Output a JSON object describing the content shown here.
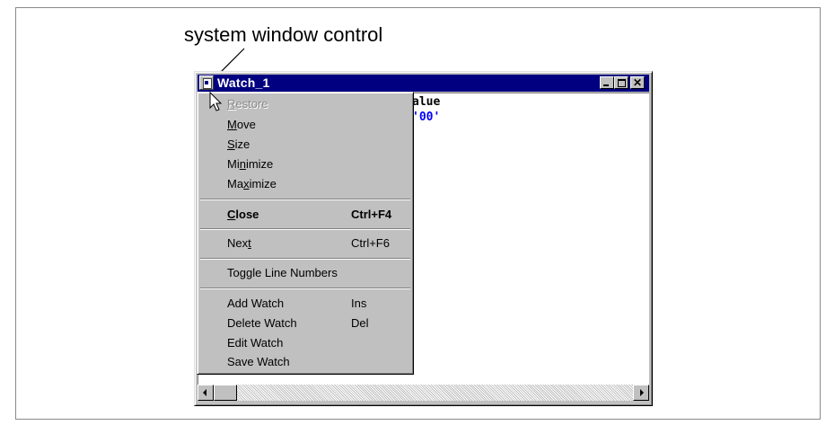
{
  "caption": "system window control",
  "window": {
    "title": "Watch_1",
    "header_fragment": "alue",
    "value_fragment": "'00'"
  },
  "system_menu": {
    "items": [
      {
        "label": "Restore",
        "shortcut": "",
        "disabled": true
      },
      {
        "label": "Move",
        "shortcut": ""
      },
      {
        "label": "Size",
        "shortcut": ""
      },
      {
        "label": "Minimize",
        "shortcut": ""
      },
      {
        "label": "Maximize",
        "shortcut": ""
      },
      {
        "label": "Close",
        "shortcut": "Ctrl+F4",
        "bold": true
      },
      {
        "label": "Next",
        "shortcut": "Ctrl+F6"
      },
      {
        "label": "Toggle Line Numbers",
        "shortcut": ""
      },
      {
        "label": "Add Watch",
        "shortcut": "Ins"
      },
      {
        "label": "Delete Watch",
        "shortcut": "Del"
      },
      {
        "label": "Edit Watch",
        "shortcut": ""
      },
      {
        "label": "Save Watch",
        "shortcut": ""
      }
    ]
  },
  "colors": {
    "titlebar": "#000080",
    "face": "#c0c0c0",
    "value_text": "#0000ff"
  }
}
